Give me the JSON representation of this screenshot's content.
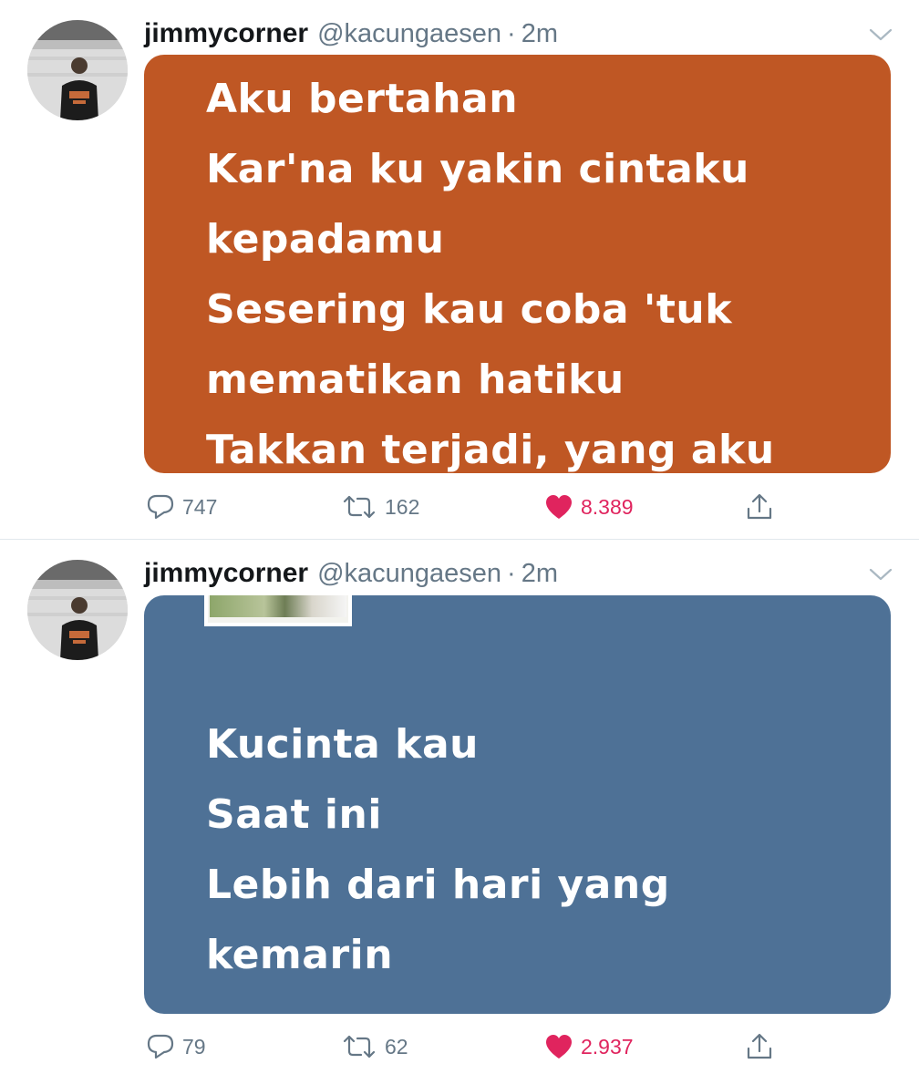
{
  "tweets": [
    {
      "name": "jimmycorner",
      "handle": "@kacungaesen",
      "separator": "·",
      "time": "2m",
      "media": {
        "background": "#bf5724",
        "lines": [
          "Aku bertahan",
          "Kar'na ku yakin cintaku",
          "kepadamu",
          "Sesering kau coba 'tuk",
          "mematikan hatiku",
          "Takkan terjadi, yang aku"
        ]
      },
      "actions": {
        "replies": "747",
        "retweets": "162",
        "likes": "8.389"
      }
    },
    {
      "name": "jimmycorner",
      "handle": "@kacungaesen",
      "separator": "·",
      "time": "2m",
      "media": {
        "background": "#4e7196",
        "lines": [
          "Kucinta kau",
          "Saat ini",
          "Lebih dari hari yang",
          "kemarin"
        ]
      },
      "actions": {
        "replies": "79",
        "retweets": "62",
        "likes": "2.937"
      }
    }
  ],
  "colors": {
    "like": "#e0245e",
    "muted": "#657786",
    "divider": "#e1e8ed"
  },
  "icons": [
    "reply-icon",
    "retweet-icon",
    "heart-icon",
    "share-icon",
    "chevron-down-icon"
  ]
}
